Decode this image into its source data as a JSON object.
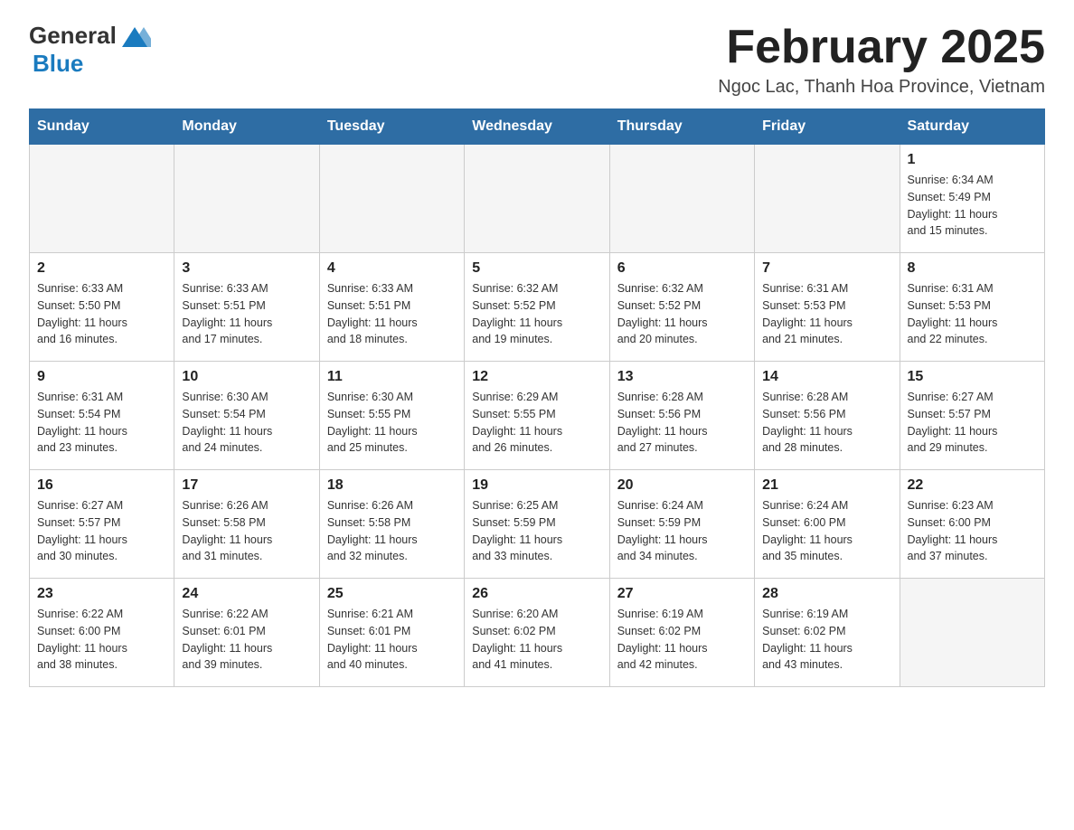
{
  "logo": {
    "general": "General",
    "blue": "Blue"
  },
  "title": {
    "month": "February 2025",
    "location": "Ngoc Lac, Thanh Hoa Province, Vietnam"
  },
  "weekdays": [
    "Sunday",
    "Monday",
    "Tuesday",
    "Wednesday",
    "Thursday",
    "Friday",
    "Saturday"
  ],
  "weeks": [
    [
      {
        "day": "",
        "info": "",
        "empty": true
      },
      {
        "day": "",
        "info": "",
        "empty": true
      },
      {
        "day": "",
        "info": "",
        "empty": true
      },
      {
        "day": "",
        "info": "",
        "empty": true
      },
      {
        "day": "",
        "info": "",
        "empty": true
      },
      {
        "day": "",
        "info": "",
        "empty": true
      },
      {
        "day": "1",
        "info": "Sunrise: 6:34 AM\nSunset: 5:49 PM\nDaylight: 11 hours\nand 15 minutes.",
        "empty": false
      }
    ],
    [
      {
        "day": "2",
        "info": "Sunrise: 6:33 AM\nSunset: 5:50 PM\nDaylight: 11 hours\nand 16 minutes.",
        "empty": false
      },
      {
        "day": "3",
        "info": "Sunrise: 6:33 AM\nSunset: 5:51 PM\nDaylight: 11 hours\nand 17 minutes.",
        "empty": false
      },
      {
        "day": "4",
        "info": "Sunrise: 6:33 AM\nSunset: 5:51 PM\nDaylight: 11 hours\nand 18 minutes.",
        "empty": false
      },
      {
        "day": "5",
        "info": "Sunrise: 6:32 AM\nSunset: 5:52 PM\nDaylight: 11 hours\nand 19 minutes.",
        "empty": false
      },
      {
        "day": "6",
        "info": "Sunrise: 6:32 AM\nSunset: 5:52 PM\nDaylight: 11 hours\nand 20 minutes.",
        "empty": false
      },
      {
        "day": "7",
        "info": "Sunrise: 6:31 AM\nSunset: 5:53 PM\nDaylight: 11 hours\nand 21 minutes.",
        "empty": false
      },
      {
        "day": "8",
        "info": "Sunrise: 6:31 AM\nSunset: 5:53 PM\nDaylight: 11 hours\nand 22 minutes.",
        "empty": false
      }
    ],
    [
      {
        "day": "9",
        "info": "Sunrise: 6:31 AM\nSunset: 5:54 PM\nDaylight: 11 hours\nand 23 minutes.",
        "empty": false
      },
      {
        "day": "10",
        "info": "Sunrise: 6:30 AM\nSunset: 5:54 PM\nDaylight: 11 hours\nand 24 minutes.",
        "empty": false
      },
      {
        "day": "11",
        "info": "Sunrise: 6:30 AM\nSunset: 5:55 PM\nDaylight: 11 hours\nand 25 minutes.",
        "empty": false
      },
      {
        "day": "12",
        "info": "Sunrise: 6:29 AM\nSunset: 5:55 PM\nDaylight: 11 hours\nand 26 minutes.",
        "empty": false
      },
      {
        "day": "13",
        "info": "Sunrise: 6:28 AM\nSunset: 5:56 PM\nDaylight: 11 hours\nand 27 minutes.",
        "empty": false
      },
      {
        "day": "14",
        "info": "Sunrise: 6:28 AM\nSunset: 5:56 PM\nDaylight: 11 hours\nand 28 minutes.",
        "empty": false
      },
      {
        "day": "15",
        "info": "Sunrise: 6:27 AM\nSunset: 5:57 PM\nDaylight: 11 hours\nand 29 minutes.",
        "empty": false
      }
    ],
    [
      {
        "day": "16",
        "info": "Sunrise: 6:27 AM\nSunset: 5:57 PM\nDaylight: 11 hours\nand 30 minutes.",
        "empty": false
      },
      {
        "day": "17",
        "info": "Sunrise: 6:26 AM\nSunset: 5:58 PM\nDaylight: 11 hours\nand 31 minutes.",
        "empty": false
      },
      {
        "day": "18",
        "info": "Sunrise: 6:26 AM\nSunset: 5:58 PM\nDaylight: 11 hours\nand 32 minutes.",
        "empty": false
      },
      {
        "day": "19",
        "info": "Sunrise: 6:25 AM\nSunset: 5:59 PM\nDaylight: 11 hours\nand 33 minutes.",
        "empty": false
      },
      {
        "day": "20",
        "info": "Sunrise: 6:24 AM\nSunset: 5:59 PM\nDaylight: 11 hours\nand 34 minutes.",
        "empty": false
      },
      {
        "day": "21",
        "info": "Sunrise: 6:24 AM\nSunset: 6:00 PM\nDaylight: 11 hours\nand 35 minutes.",
        "empty": false
      },
      {
        "day": "22",
        "info": "Sunrise: 6:23 AM\nSunset: 6:00 PM\nDaylight: 11 hours\nand 37 minutes.",
        "empty": false
      }
    ],
    [
      {
        "day": "23",
        "info": "Sunrise: 6:22 AM\nSunset: 6:00 PM\nDaylight: 11 hours\nand 38 minutes.",
        "empty": false
      },
      {
        "day": "24",
        "info": "Sunrise: 6:22 AM\nSunset: 6:01 PM\nDaylight: 11 hours\nand 39 minutes.",
        "empty": false
      },
      {
        "day": "25",
        "info": "Sunrise: 6:21 AM\nSunset: 6:01 PM\nDaylight: 11 hours\nand 40 minutes.",
        "empty": false
      },
      {
        "day": "26",
        "info": "Sunrise: 6:20 AM\nSunset: 6:02 PM\nDaylight: 11 hours\nand 41 minutes.",
        "empty": false
      },
      {
        "day": "27",
        "info": "Sunrise: 6:19 AM\nSunset: 6:02 PM\nDaylight: 11 hours\nand 42 minutes.",
        "empty": false
      },
      {
        "day": "28",
        "info": "Sunrise: 6:19 AM\nSunset: 6:02 PM\nDaylight: 11 hours\nand 43 minutes.",
        "empty": false
      },
      {
        "day": "",
        "info": "",
        "empty": true
      }
    ]
  ]
}
